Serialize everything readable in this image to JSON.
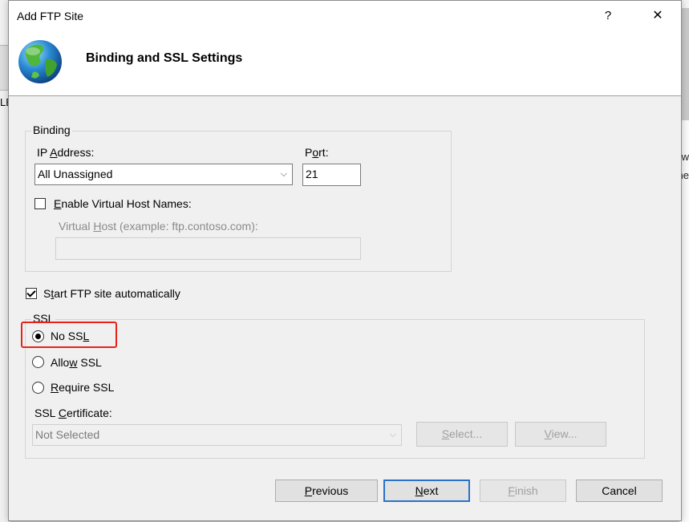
{
  "background": {
    "left_text": "LE",
    "right_text_1": "w",
    "right_text_2": "ne"
  },
  "dialog": {
    "title": "Add FTP Site",
    "help_label": "?",
    "close_label": "✕",
    "header_title": "Binding and SSL Settings"
  },
  "binding": {
    "group_label": "Binding",
    "ip_label_pre": "IP ",
    "ip_label_key": "A",
    "ip_label_post": "ddress:",
    "ip_value": "All Unassigned",
    "port_label_pre": "P",
    "port_label_key": "o",
    "port_label_post": "rt:",
    "port_value": "21",
    "vhost_check_key": "E",
    "vhost_check_post": "nable Virtual Host Names:",
    "vhost_check_checked": false,
    "vhost_label_pre": "Virtual ",
    "vhost_label_key": "H",
    "vhost_label_post": "ost (example: ftp.contoso.com):",
    "vhost_value": ""
  },
  "start_auto": {
    "pre": "S",
    "key": "t",
    "post": "art FTP site automatically",
    "checked": true
  },
  "ssl": {
    "group_label": "SSL",
    "options": [
      {
        "pre": "No SS",
        "key": "L",
        "post": "",
        "checked": true
      },
      {
        "pre": "Allo",
        "key": "w",
        "post": " SSL",
        "checked": false
      },
      {
        "pre": "",
        "key": "R",
        "post": "equire SSL",
        "checked": false
      }
    ],
    "cert_label_pre": "SSL ",
    "cert_label_key": "C",
    "cert_label_post": "ertificate:",
    "cert_value": "Not Selected",
    "select_btn_key": "S",
    "select_btn_post": "elect...",
    "view_btn_key": "V",
    "view_btn_post": "iew..."
  },
  "footer": {
    "previous_key": "P",
    "previous_post": "revious",
    "next_key": "N",
    "next_post": "ext",
    "finish_key": "F",
    "finish_post": "inish",
    "cancel": "Cancel"
  },
  "colors": {
    "highlight": "#e8221a",
    "default_button_border": "#2a72c9"
  }
}
